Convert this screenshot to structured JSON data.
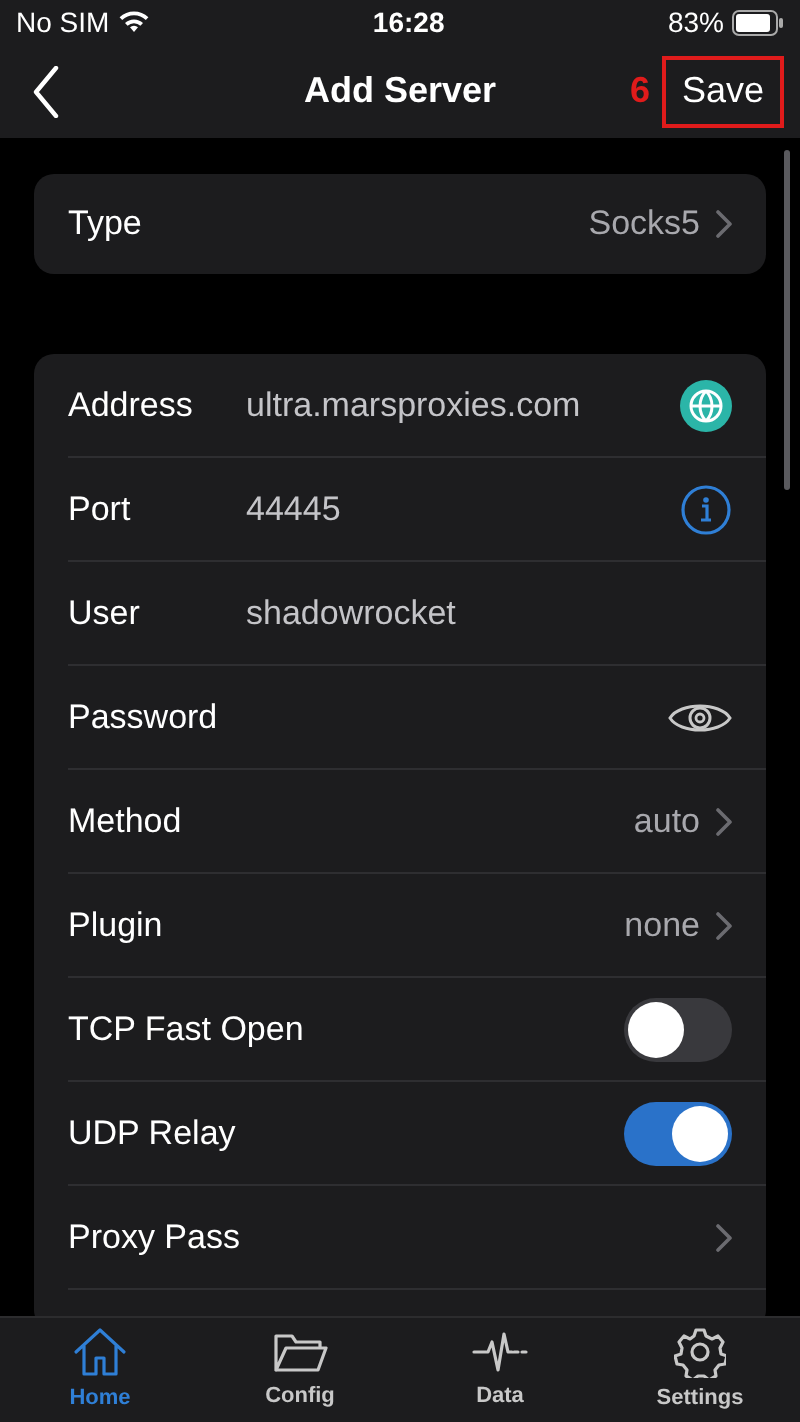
{
  "status_bar": {
    "carrier": "No SIM",
    "time": "16:28",
    "battery": "83%"
  },
  "nav": {
    "title": "Add Server",
    "step_marker": "6",
    "action": "Save"
  },
  "type_row": {
    "label": "Type",
    "value": "Socks5"
  },
  "rows": [
    {
      "kind": "address",
      "label": "Address",
      "value": "ultra.marsproxies.com"
    },
    {
      "kind": "info",
      "label": "Port",
      "value": "44445"
    },
    {
      "kind": "field",
      "label": "User",
      "value": "shadowrocket"
    },
    {
      "kind": "secret",
      "label": "Password"
    },
    {
      "kind": "picker",
      "label": "Method",
      "value": "auto"
    },
    {
      "kind": "picker",
      "label": "Plugin",
      "value": "none"
    },
    {
      "kind": "toggle",
      "label": "TCP Fast Open",
      "on": false
    },
    {
      "kind": "toggle",
      "label": "UDP Relay",
      "on": true
    },
    {
      "kind": "picker",
      "label": "Proxy Pass"
    }
  ],
  "tab_bar": [
    {
      "label": "Home",
      "selected": true
    },
    {
      "label": "Config",
      "selected": false
    },
    {
      "label": "Data",
      "selected": false
    },
    {
      "label": "Settings",
      "selected": false
    }
  ]
}
